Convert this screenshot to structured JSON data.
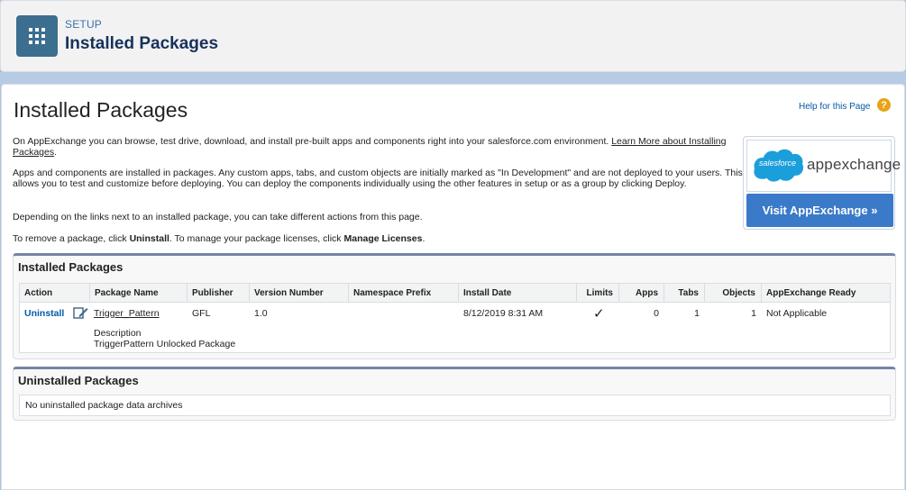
{
  "header": {
    "crumb": "SETUP",
    "title": "Installed Packages"
  },
  "page": {
    "title": "Installed Packages",
    "help_link": "Help for this Page",
    "intro_text": "On AppExchange you can browse, test drive, download, and install pre-built apps and components right into your salesforce.com environment.",
    "learn_more_link": "Learn More about Installing Packages",
    "para2": "Apps and components are installed in packages. Any custom apps, tabs, and custom objects are initially marked as \"In Development\" and are not deployed to your users. This allows you to test and customize before deploying. You can deploy the components individually using the other features in setup or as a group by clicking Deploy.",
    "para3": "Depending on the links next to an installed package, you can take different actions from this page.",
    "para4_pre": "To remove a package, click ",
    "para4_uninstall": "Uninstall",
    "para4_mid": ". To manage your package licenses, click ",
    "para4_manage": "Manage Licenses",
    "para4_post": "."
  },
  "appexchange": {
    "salesforce_text": "salesforce",
    "word": "appexchange",
    "button": "Visit AppExchange »"
  },
  "installed": {
    "title": "Installed Packages",
    "columns": [
      "Action",
      "Package Name",
      "Publisher",
      "Version Number",
      "Namespace Prefix",
      "Install Date",
      "Limits",
      "Apps",
      "Tabs",
      "Objects",
      "AppExchange Ready"
    ],
    "row": {
      "action": "Uninstall",
      "package_name": "Trigger_Pattern",
      "publisher": "GFL",
      "version": "1.0",
      "namespace": "",
      "install_date": "8/12/2019 8:31 AM",
      "limits": "✓",
      "apps": "0",
      "tabs": "1",
      "objects": "1",
      "appexchange_ready": "Not Applicable",
      "description_label": "Description",
      "description": "TriggerPattern Unlocked Package"
    }
  },
  "uninstalled": {
    "title": "Uninstalled Packages",
    "empty_text": "No uninstalled package data archives"
  },
  "colors": {
    "accent": "#3c6e8f",
    "link": "#015ba7",
    "button": "#3a7ac8",
    "section_border": "#7485a5"
  }
}
